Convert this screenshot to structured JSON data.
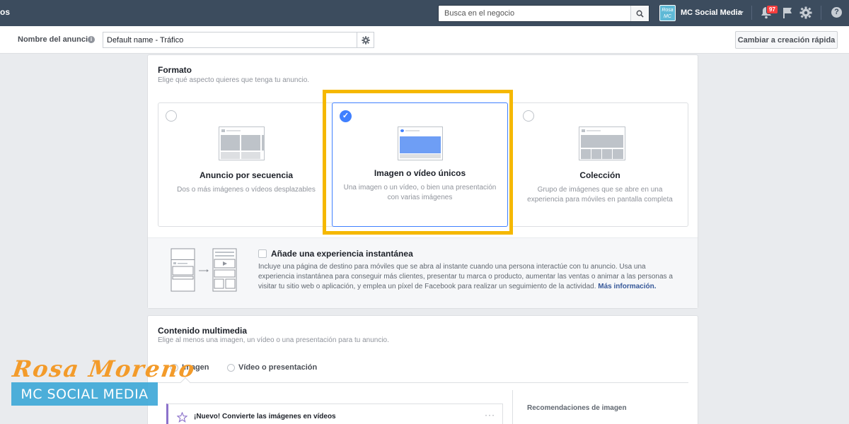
{
  "topbar": {
    "left_fragment": "os",
    "search_placeholder": "Busca en el negocio",
    "avatar_text": "Rosa MC",
    "account_name": "MC Social Media",
    "notifications_count": "97"
  },
  "namebar": {
    "label": "Nombre del anuncio",
    "value": "Default name - Tráfico",
    "quick_button": "Cambiar a creación rápida"
  },
  "formato": {
    "title": "Formato",
    "subtitle": "Elige qué aspecto quieres que tenga tu anuncio.",
    "options": [
      {
        "title": "Anuncio por secuencia",
        "desc": "Dos o más imágenes o vídeos desplazables",
        "selected": false
      },
      {
        "title": "Imagen o vídeo únicos",
        "desc": "Una imagen o un vídeo, o bien una presentación con varias imágenes",
        "selected": true
      },
      {
        "title": "Colección",
        "desc": "Grupo de imágenes que se abre en una experiencia para móviles en pantalla completa",
        "selected": false
      }
    ],
    "instant": {
      "title": "Añade una experiencia instantánea",
      "desc": "Incluye una página de destino para móviles que se abra al instante cuando una persona interactúe con tu anuncio. Usa una experiencia instantánea para conseguir más clientes, presentar tu marca o producto, aumentar las ventas o animar a las personas a visitar tu sitio web o aplicación, y emplea un píxel de Facebook para realizar un seguimiento de la actividad.",
      "link": "Más información."
    }
  },
  "media": {
    "title": "Contenido multimedia",
    "subtitle": "Elige al menos una imagen, un vídeo o una presentación para tu anuncio.",
    "tabs": [
      {
        "label": "Imagen",
        "selected": true
      },
      {
        "label": "Vídeo o presentación",
        "selected": false
      }
    ],
    "promo": "¡Nuevo! Convierte las imágenes en vídeos",
    "recommendations": "Recomendaciones de imagen"
  },
  "watermark": {
    "script": "Rosa Moreno",
    "bar": "MC SOCIAL MEDIA"
  },
  "colors": {
    "topbar": "#3c4c5e",
    "accent_blue": "#4080ff",
    "highlight": "#f5b800",
    "badge": "#fa3e3e"
  }
}
